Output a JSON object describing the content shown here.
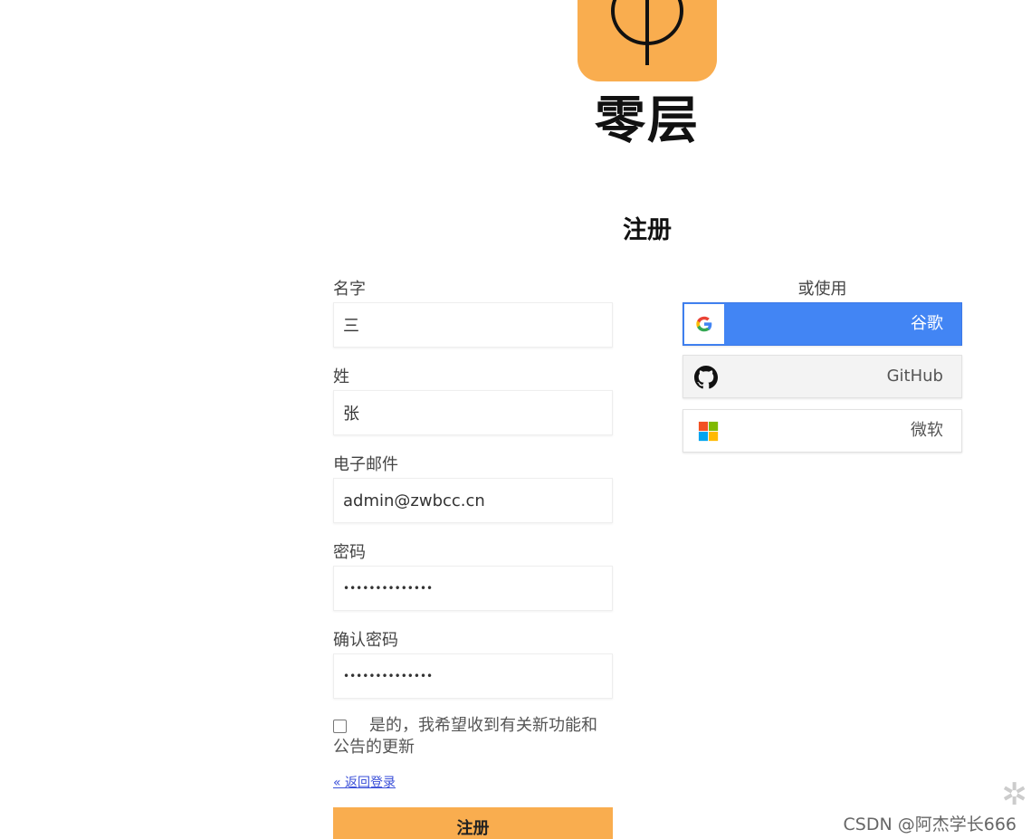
{
  "brand": {
    "name": "零层",
    "logo_color": "#f9ad4f"
  },
  "form": {
    "title": "注册",
    "first_name": {
      "label": "名字",
      "value": "三"
    },
    "last_name": {
      "label": "姓",
      "value": "张"
    },
    "email": {
      "label": "电子邮件",
      "value": "admin@zwbcc.cn"
    },
    "password": {
      "label": "密码",
      "value": "••••••••••••••"
    },
    "confirm_password": {
      "label": "确认密码",
      "value": "••••••••••••••"
    },
    "consent": {
      "checked": false,
      "text": "是的，我希望收到有关新功能和公告的更新"
    },
    "back_link": "« 返回登录",
    "submit_label": "注册"
  },
  "social": {
    "title": "或使用",
    "buttons": [
      {
        "label": "谷歌",
        "icon": "google-icon",
        "color": "#4285f4"
      },
      {
        "label": "GitHub",
        "icon": "github-icon"
      },
      {
        "label": "微软",
        "icon": "microsoft-icon"
      }
    ]
  },
  "watermark": "CSDN @阿杰学长666"
}
